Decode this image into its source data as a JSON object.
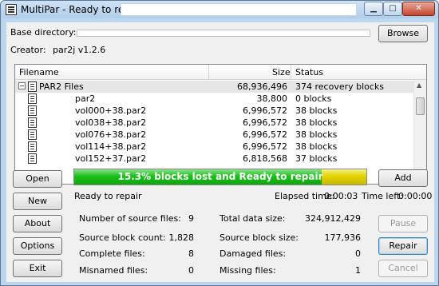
{
  "window": {
    "title": "MultiPar - Ready to repair",
    "app_icon": "par-file-icon",
    "controls": [
      "minimize-icon",
      "maximize-icon",
      "close-icon"
    ]
  },
  "base_directory": {
    "label": "Base directory:",
    "value": "",
    "browse_label": "Browse"
  },
  "creator": {
    "label": "Creator:",
    "value": "par2j v1.2.6"
  },
  "file_list": {
    "columns": [
      "Filename",
      "Size",
      "Status"
    ],
    "rows": [
      {
        "name": "PAR2 Files",
        "size": "68,936,496",
        "status": "374 recovery blocks",
        "group": true,
        "expander": "−"
      },
      {
        "name": "par2",
        "size": "38,800",
        "status": "0 blocks"
      },
      {
        "name": "vol000+38.par2",
        "size": "6,996,572",
        "status": "38 blocks"
      },
      {
        "name": "vol038+38.par2",
        "size": "6,996,572",
        "status": "38 blocks"
      },
      {
        "name": "vol076+38.par2",
        "size": "6,996,572",
        "status": "38 blocks"
      },
      {
        "name": "vol114+38.par2",
        "size": "6,996,572",
        "status": "38 blocks"
      },
      {
        "name": "vol152+37.par2",
        "size": "6,818,568",
        "status": "37 blocks"
      }
    ]
  },
  "buttons": {
    "open": "Open",
    "new": "New",
    "about": "About",
    "options": "Options",
    "exit": "Exit",
    "add": "Add",
    "pause": "Pause",
    "repair": "Repair",
    "cancel": "Cancel"
  },
  "progress": {
    "text": "15.3% blocks lost and Ready to repair",
    "lost_fraction": 0.153,
    "green_fraction": 0.847,
    "green_color": "#18c018",
    "yellow_color": "#e3d400"
  },
  "status": {
    "message": "Ready to repair",
    "elapsed_label": "Elapsed time:",
    "elapsed_value": "0:00:03",
    "left_label": "Time left:",
    "left_value": "0:00:00"
  },
  "stats": {
    "source_files_label": "Number of source files:",
    "source_files_value": "9",
    "source_blocks_label": "Source block count:",
    "source_blocks_value": "1,828",
    "complete_label": "Complete files:",
    "complete_value": "8",
    "misnamed_label": "Misnamed files:",
    "misnamed_value": "0",
    "total_size_label": "Total data size:",
    "total_size_value": "324,912,429",
    "block_size_label": "Source block size:",
    "block_size_value": "177,936",
    "damaged_label": "Damaged files:",
    "damaged_value": "0",
    "missing_label": "Missing files:",
    "missing_value": "1"
  }
}
